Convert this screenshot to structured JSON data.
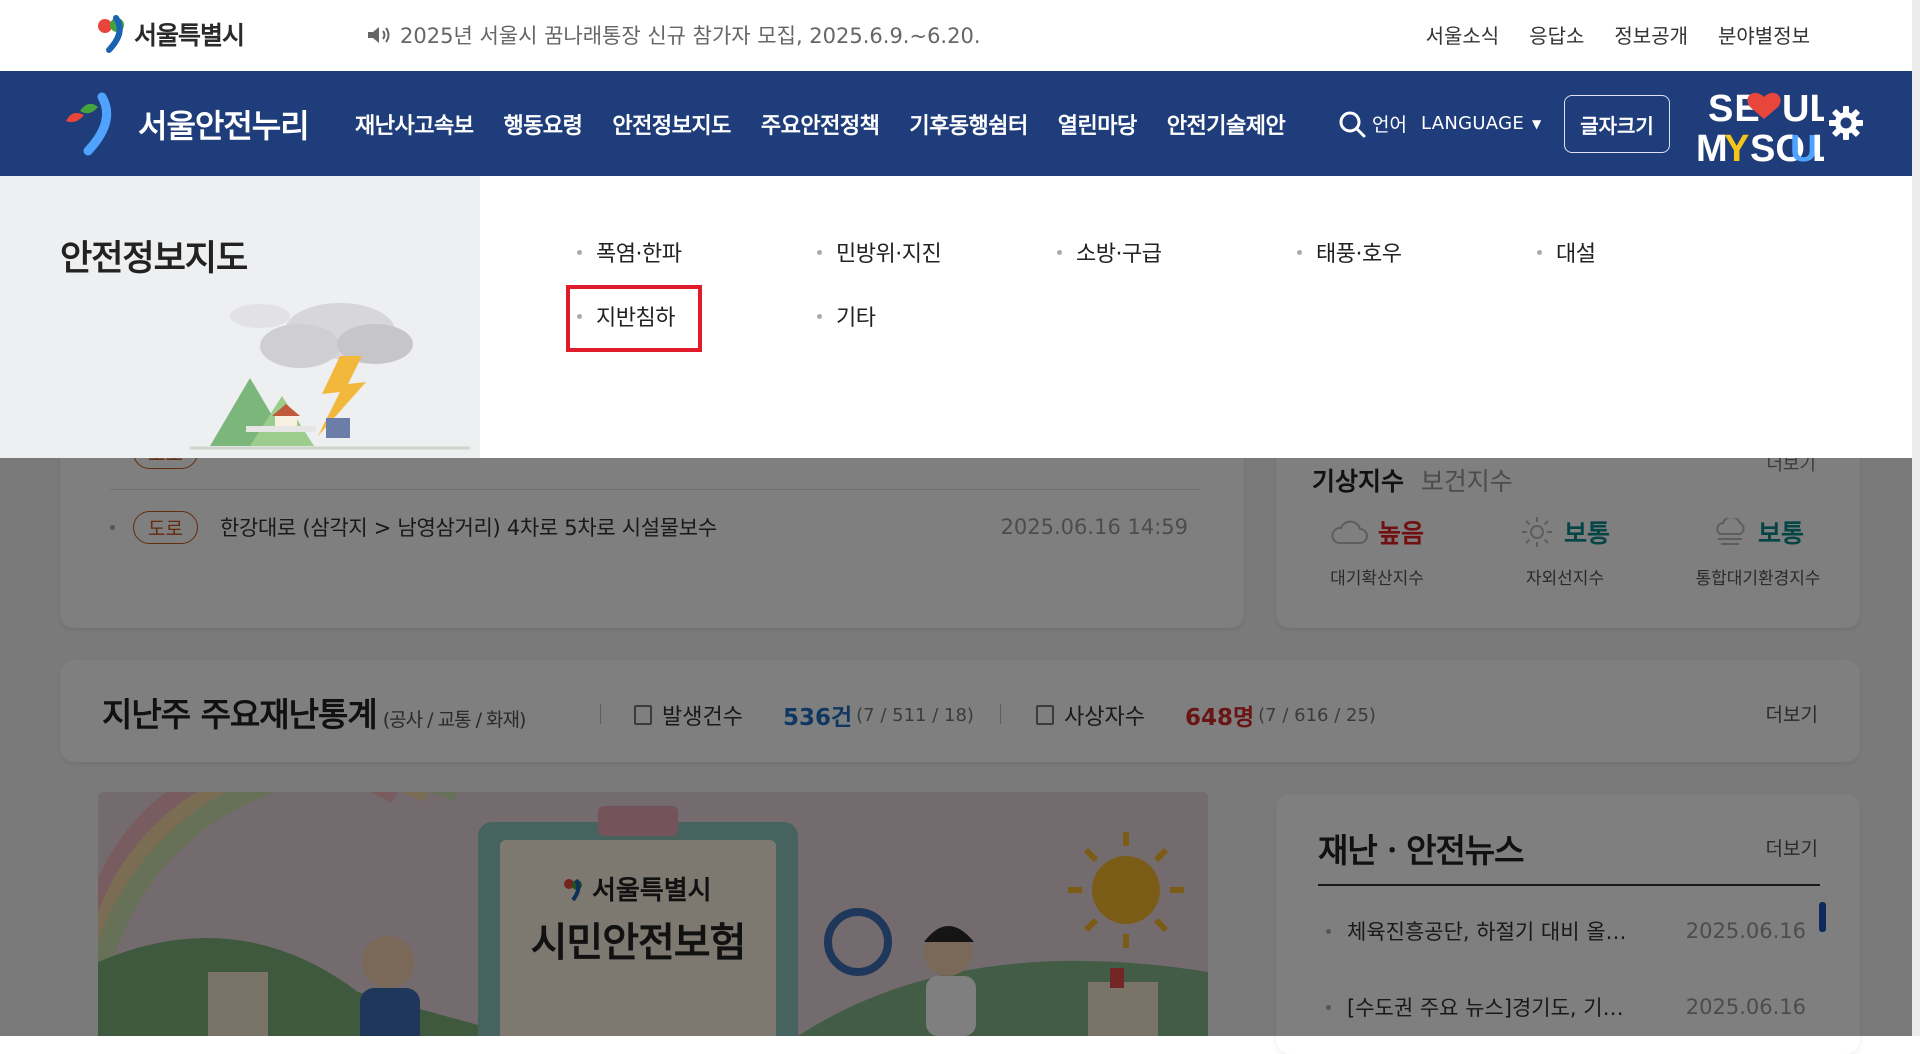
{
  "utility": {
    "logo_text": "서울특별시",
    "notice": "2025년 서울시 꿈나래통장 신규 참가자 모집, 2025.6.9.~6.20.",
    "links": [
      "서울소식",
      "응답소",
      "정보공개",
      "분야별정보"
    ]
  },
  "nav": {
    "logo_text": "서울안전누리",
    "menu": [
      "재난사고속보",
      "행동요령",
      "안전정보지도",
      "주요안전정책",
      "기후동행쉼터",
      "열린마당",
      "안전기술제안"
    ],
    "search_label": "언어",
    "language": "LANGUAGE",
    "fontsize_button": "글자크기",
    "brand_logo": "SEOUL MY SOUL",
    "colors": {
      "nav_bg": "#1f3d7a"
    }
  },
  "mega": {
    "title": "안전정보지도",
    "items": [
      "폭염·한파",
      "민방위·지진",
      "소방·구급",
      "태풍·호우",
      "대설",
      "지반침하",
      "기타"
    ],
    "highlighted": "지반침하",
    "colors": {
      "highlight": "#e01b2b"
    }
  },
  "traffic": {
    "rows": [
      {
        "tag": "도로",
        "text": "",
        "date": ""
      },
      {
        "tag": "도로",
        "text": "한강대로 (삼각지 > 남영삼거리) 4차로 5차로 시설물보수",
        "date": "2025.06.16 14:59"
      }
    ]
  },
  "weather": {
    "tab_active": "기상지수",
    "tab_inactive": "보건지수",
    "more": "더보기",
    "indices": [
      {
        "level": "높음",
        "name": "대기확산지수",
        "color": "#e02020"
      },
      {
        "level": "보통",
        "name": "자외선지수",
        "color": "#0a8a8a"
      },
      {
        "level": "보통",
        "name": "통합대기환경지수",
        "color": "#0a8a8a"
      }
    ]
  },
  "stats": {
    "title": "지난주 주요재난통계",
    "subtitle": "(공사 / 교통 / 화재)",
    "occ_label": "발생건수",
    "occ_value": "536건",
    "occ_detail": "(7 / 511 / 18)",
    "cas_label": "사상자수",
    "cas_value": "648명",
    "cas_detail": "(7 / 616 / 25)",
    "more": "더보기"
  },
  "banner": {
    "org": "서울특별시",
    "headline": "시민안전보험"
  },
  "news": {
    "title": "재난ㆍ안전뉴스",
    "more": "더보기",
    "items": [
      {
        "title": "체육진흥공단, 하절기 대비 올…",
        "date": "2025.06.16"
      },
      {
        "title": "[수도권 주요 뉴스]경기도, 기…",
        "date": "2025.06.16"
      }
    ]
  }
}
